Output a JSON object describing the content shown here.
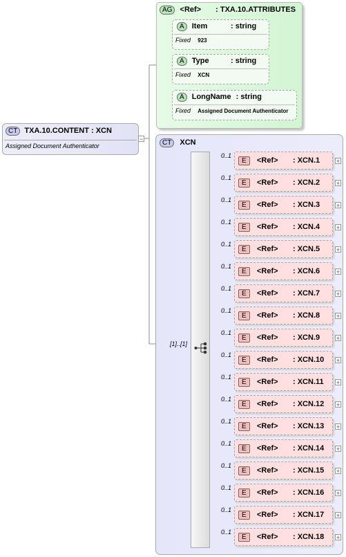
{
  "attribute_group": {
    "badge": "AG",
    "ref_label": "<Ref>",
    "type": ": TXA.10.ATTRIBUTES",
    "attributes": [
      {
        "badge": "A",
        "name": "Item",
        "type": ": string",
        "fixed_label": "Fixed",
        "fixed_value": "923"
      },
      {
        "badge": "A",
        "name": "Type",
        "type": ": string",
        "fixed_label": "Fixed",
        "fixed_value": "XCN"
      },
      {
        "badge": "A",
        "name": "LongName",
        "type": ": string",
        "fixed_label": "Fixed",
        "fixed_value": "Assigned Document Authenticator"
      }
    ]
  },
  "complex_type_root": {
    "badge": "CT",
    "title": "TXA.10.CONTENT : XCN",
    "documentation": "Assigned Document Authenticator"
  },
  "complex_type_xcn": {
    "badge": "CT",
    "name": "XCN",
    "cardinality": "[1]..[1]"
  },
  "elements": [
    {
      "badge": "E",
      "ref": "<Ref>",
      "type": ": XCN.1",
      "occurs": "0..1"
    },
    {
      "badge": "E",
      "ref": "<Ref>",
      "type": ": XCN.2",
      "occurs": "0..1"
    },
    {
      "badge": "E",
      "ref": "<Ref>",
      "type": ": XCN.3",
      "occurs": "0..1"
    },
    {
      "badge": "E",
      "ref": "<Ref>",
      "type": ": XCN.4",
      "occurs": "0..1"
    },
    {
      "badge": "E",
      "ref": "<Ref>",
      "type": ": XCN.5",
      "occurs": "0..1"
    },
    {
      "badge": "E",
      "ref": "<Ref>",
      "type": ": XCN.6",
      "occurs": "0..1"
    },
    {
      "badge": "E",
      "ref": "<Ref>",
      "type": ": XCN.7",
      "occurs": "0..1"
    },
    {
      "badge": "E",
      "ref": "<Ref>",
      "type": ": XCN.8",
      "occurs": "0..1"
    },
    {
      "badge": "E",
      "ref": "<Ref>",
      "type": ": XCN.9",
      "occurs": "0..1"
    },
    {
      "badge": "E",
      "ref": "<Ref>",
      "type": ": XCN.10",
      "occurs": "0..1"
    },
    {
      "badge": "E",
      "ref": "<Ref>",
      "type": ": XCN.11",
      "occurs": "0..1"
    },
    {
      "badge": "E",
      "ref": "<Ref>",
      "type": ": XCN.12",
      "occurs": "0..1"
    },
    {
      "badge": "E",
      "ref": "<Ref>",
      "type": ": XCN.13",
      "occurs": "0..1"
    },
    {
      "badge": "E",
      "ref": "<Ref>",
      "type": ": XCN.14",
      "occurs": "0..1"
    },
    {
      "badge": "E",
      "ref": "<Ref>",
      "type": ": XCN.15",
      "occurs": "0..1"
    },
    {
      "badge": "E",
      "ref": "<Ref>",
      "type": ": XCN.16",
      "occurs": "0..1"
    },
    {
      "badge": "E",
      "ref": "<Ref>",
      "type": ": XCN.17",
      "occurs": "0..1"
    },
    {
      "badge": "E",
      "ref": "<Ref>",
      "type": ": XCN.18",
      "occurs": "0..1"
    }
  ],
  "icons": {
    "expand": "plus-icon",
    "collapse": "minus-icon",
    "sequence": "sequence-icon"
  },
  "colors": {
    "attribute_group_bg": "#d8f7d8",
    "complex_type_bg": "#e6e6fb",
    "element_bg": "#ffdfdf"
  }
}
